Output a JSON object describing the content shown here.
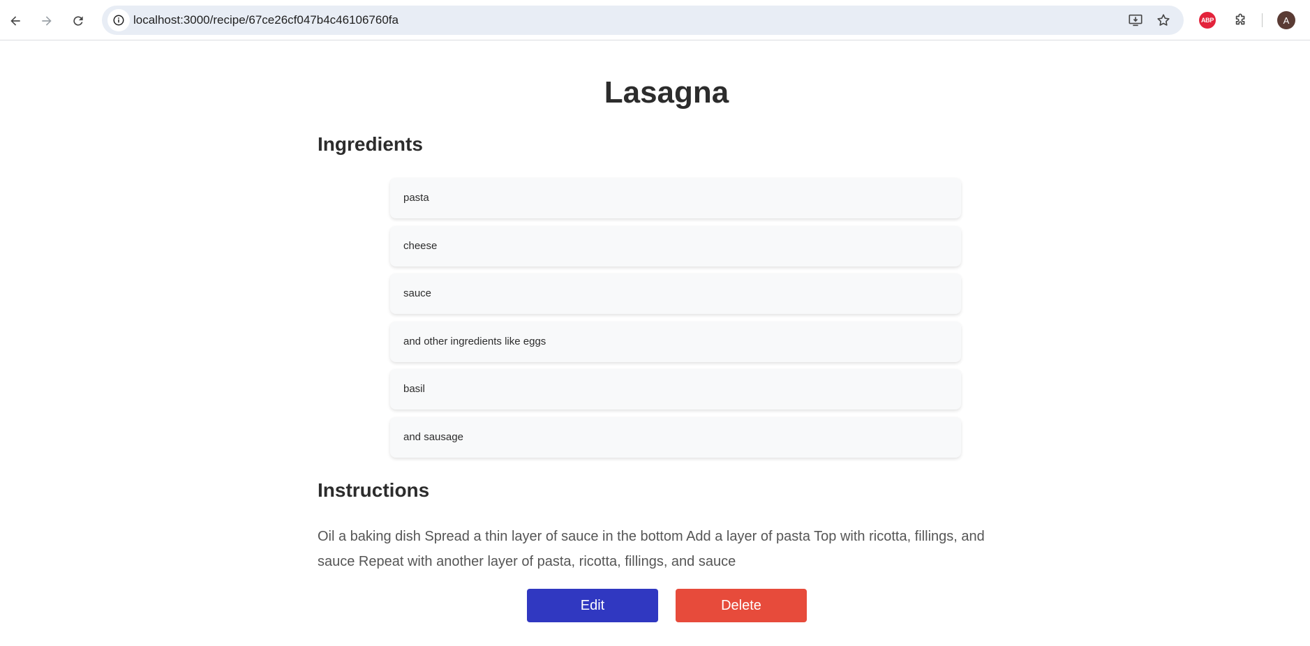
{
  "browser": {
    "url": "localhost:3000/recipe/67ce26cf047b4c46106760fa",
    "extension_badge": "ABP",
    "profile_initial": "A"
  },
  "recipe": {
    "title": "Lasagna",
    "ingredients_heading": "Ingredients",
    "ingredients": [
      "pasta",
      "cheese",
      "sauce",
      "and other ingredients like eggs",
      "basil",
      "and sausage"
    ],
    "instructions_heading": "Instructions",
    "instructions": "Oil a baking dish Spread a thin layer of sauce in the bottom Add a layer of pasta Top with ricotta, fillings, and sauce Repeat with another layer of pasta, ricotta, fillings, and sauce"
  },
  "actions": {
    "edit_label": "Edit",
    "delete_label": "Delete"
  },
  "colors": {
    "edit_button": "#3038c1",
    "delete_button": "#e74b3b",
    "card_background": "#f8f9fa",
    "omnibox_background": "#e8edf5"
  }
}
